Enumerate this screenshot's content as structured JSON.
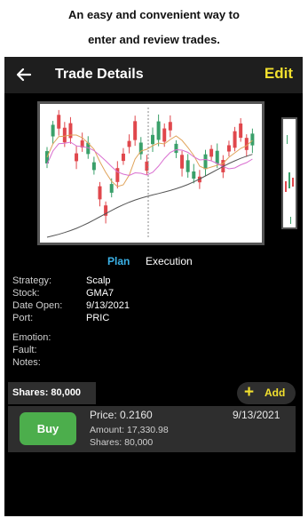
{
  "promo": {
    "line1": "An easy and convenient way to",
    "line2": "enter and review trades."
  },
  "header": {
    "title": "Trade Details",
    "edit_label": "Edit",
    "back_icon": "arrow-left-icon"
  },
  "tabs": [
    {
      "label": "Plan",
      "active": true
    },
    {
      "label": "Execution",
      "active": false
    }
  ],
  "details": [
    {
      "label": "Strategy:",
      "value": "Scalp"
    },
    {
      "label": "Stock:",
      "value": "GMA7"
    },
    {
      "label": "Date Open:",
      "value": "9/13/2021"
    },
    {
      "label": "Port:",
      "value": "PRIC"
    }
  ],
  "notes_fields": [
    {
      "label": "Emotion:"
    },
    {
      "label": "Fault:"
    },
    {
      "label": "Notes:"
    }
  ],
  "shares_tab": "Shares: 80,000",
  "add_button": {
    "label": "Add",
    "icon": "plus-icon"
  },
  "trade": {
    "action": "Buy",
    "price": "Price: 0.2160",
    "date": "9/13/2021",
    "amount": "Amount: 17,330.98",
    "shares": "Shares: 80,000"
  },
  "colors": {
    "accent_yellow": "#f2e02e",
    "tab_active": "#3bb2e8",
    "buy_green": "#4cae4c",
    "candle_up": "#3aa06a",
    "candle_down": "#e0474c"
  }
}
